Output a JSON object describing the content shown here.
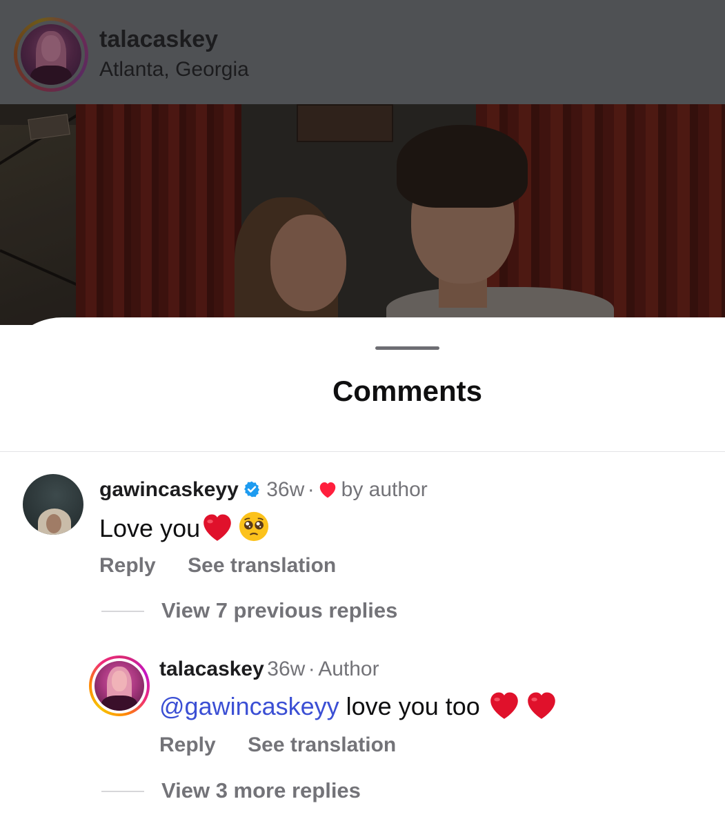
{
  "post": {
    "username": "talacaskey",
    "location": "Atlanta, Georgia"
  },
  "sheet": {
    "title": "Comments"
  },
  "comments": [
    {
      "username": "gawincaskeyy",
      "verified": true,
      "time": "36w",
      "separator": "·",
      "liked_by_author": "by author",
      "text": "Love you",
      "emojis": [
        "red-heart",
        "pleading-face"
      ],
      "actions": {
        "reply": "Reply",
        "translate": "See translation"
      },
      "view_replies": "View 7 previous replies"
    },
    {
      "username": "talacaskey",
      "time": "36w",
      "separator": "·",
      "role": "Author",
      "mention": "@gawincaskeyy",
      "text": " love you too ",
      "emojis": [
        "red-heart",
        "red-heart"
      ],
      "actions": {
        "reply": "Reply",
        "translate": "See translation"
      },
      "view_replies": "View 3 more replies"
    }
  ],
  "colors": {
    "verified": "#1d9bf0",
    "heart": "#ff1f3d",
    "mention": "#3b4fd4",
    "muted_text": "#737378"
  }
}
